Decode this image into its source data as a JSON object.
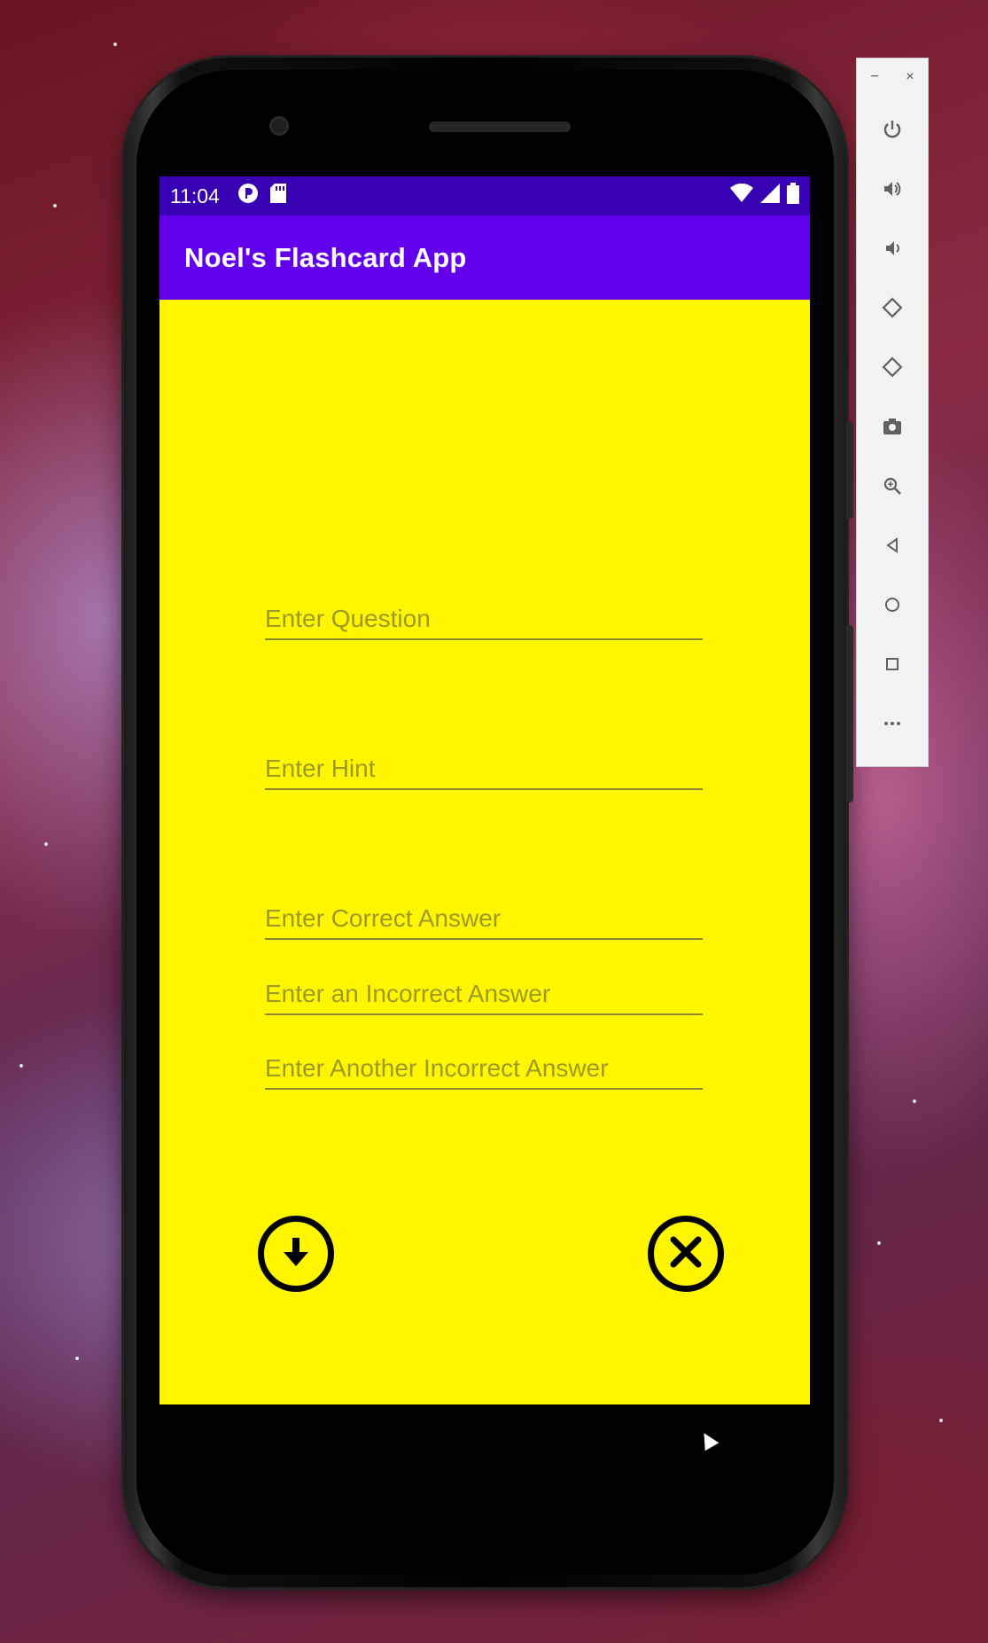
{
  "status_bar": {
    "time": "11:04",
    "left_icons": [
      "notification-p-icon",
      "sd-card-icon"
    ],
    "right_icons": [
      "wifi-icon",
      "signal-icon",
      "battery-icon"
    ],
    "background": "#3700b3"
  },
  "app_bar": {
    "title": "Noel's Flashcard App",
    "background": "#6200ee"
  },
  "content": {
    "background": "#fff600",
    "fields": {
      "question_placeholder": "Enter Question",
      "hint_placeholder": "Enter Hint",
      "correct_answer_placeholder": "Enter Correct Answer",
      "incorrect_answer_1_placeholder": "Enter an Incorrect Answer",
      "incorrect_answer_2_placeholder": "Enter Another Incorrect Answer"
    },
    "buttons": {
      "save_icon": "arrow-down-circle-icon",
      "cancel_icon": "close-circle-icon"
    }
  },
  "emulator_toolbar": {
    "window_controls": [
      "−",
      "×"
    ],
    "tools": [
      "power-icon",
      "volume-up-icon",
      "volume-down-icon",
      "rotate-left-icon",
      "rotate-right-icon",
      "camera-icon",
      "zoom-icon",
      "back-icon",
      "home-icon",
      "overview-icon",
      "more-icon"
    ]
  }
}
